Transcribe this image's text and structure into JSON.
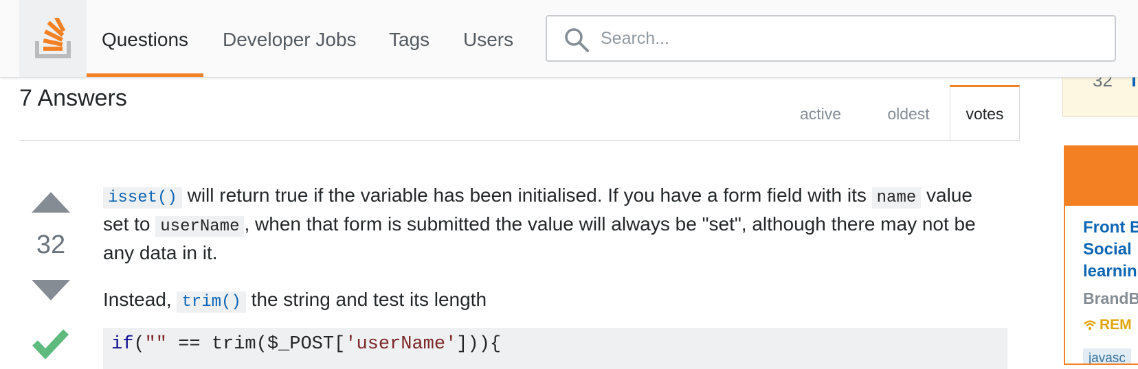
{
  "nav": {
    "items": [
      "Questions",
      "Developer Jobs",
      "Tags",
      "Users"
    ],
    "active": "Questions"
  },
  "search": {
    "placeholder": "Search..."
  },
  "answers": {
    "title": "7 Answers",
    "sort_tabs": [
      "active",
      "oldest",
      "votes"
    ],
    "sort_active": "votes"
  },
  "answer": {
    "votes": "32",
    "accepted": true,
    "p1": {
      "code1": "isset()",
      "t1": " will return true if the variable has been initialised. If you have a form field with its ",
      "code2": "name",
      "t2": " value set to ",
      "code3": "userName",
      "t3": ", when that form is submitted the value will always be \"set\", although there may not be any data in it."
    },
    "p2": {
      "t1": "Instead, ",
      "code": "trim()",
      "t2": " the string and test its length"
    },
    "code_block": {
      "kw": "if",
      "t1": "(",
      "s1": "\"\"",
      "t2": " == trim($_POST[",
      "s2": "'userName'",
      "t3": "])){"
    }
  },
  "sidebar": {
    "top_number": "32",
    "ad": {
      "title": "Front B\nSocial\nlearnin",
      "company": "BrandB",
      "remote": "REM",
      "tag": "javasc"
    }
  },
  "colors": {
    "accent": "#f48024",
    "link": "#0c65b5",
    "accepted": "#5eba7d",
    "vote_arrow": "#858c93"
  }
}
